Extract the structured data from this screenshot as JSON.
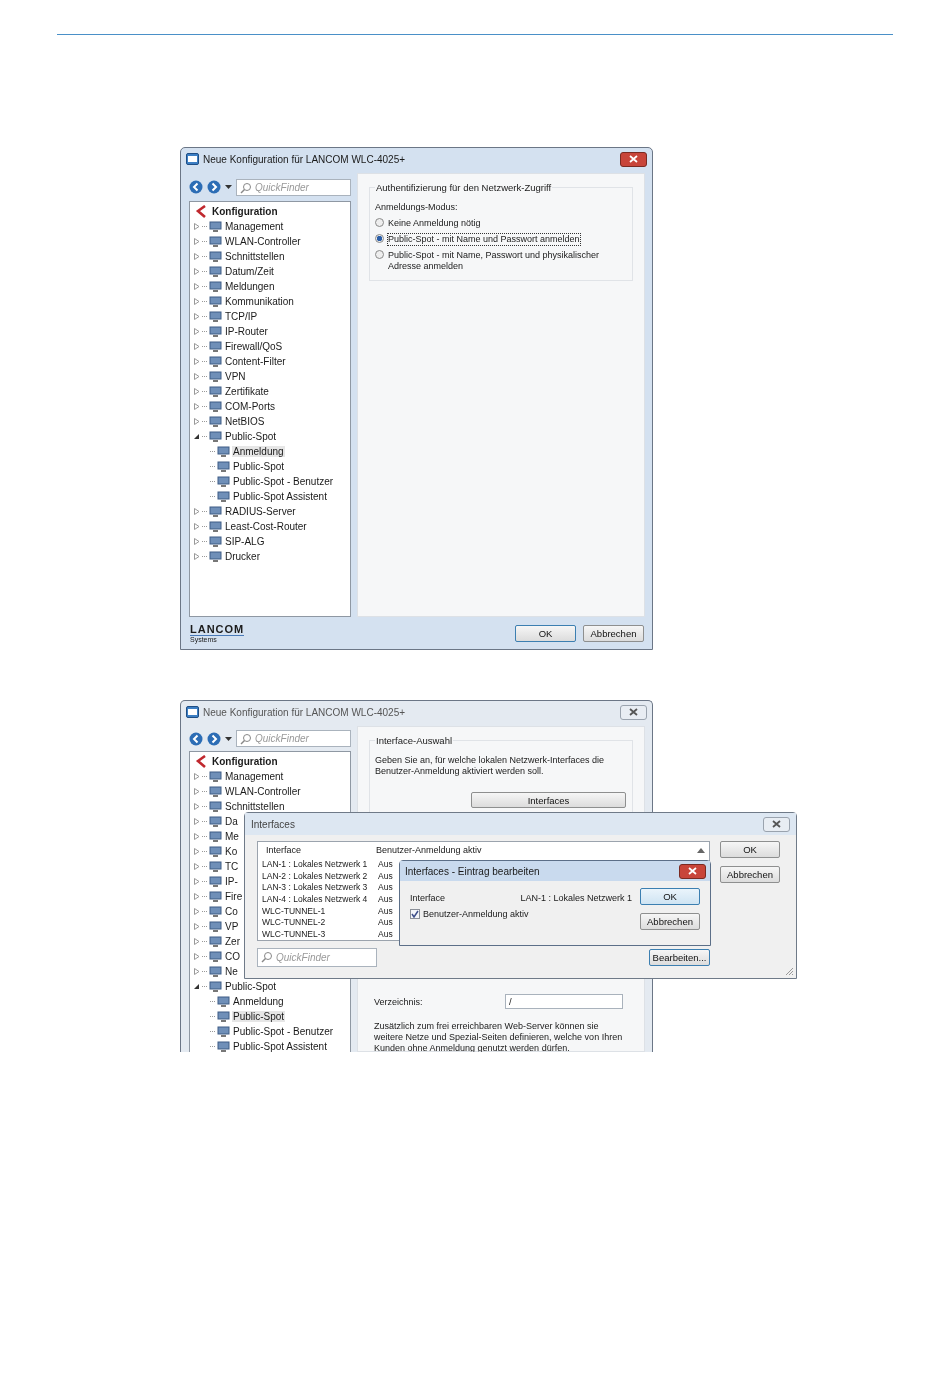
{
  "window_1": {
    "active": true,
    "title": "Neue Konfiguration für LANCOM WLC-4025+",
    "quickfinder": {
      "placeholder": "QuickFinder"
    },
    "tree": {
      "root": "Konfiguration",
      "items": [
        {
          "label": "Management",
          "expanded": false,
          "selected": false
        },
        {
          "label": "WLAN-Controller",
          "expanded": false,
          "selected": false
        },
        {
          "label": "Schnittstellen",
          "expanded": false,
          "selected": false
        },
        {
          "label": "Datum/Zeit",
          "expanded": false,
          "selected": false
        },
        {
          "label": "Meldungen",
          "expanded": false,
          "selected": false
        },
        {
          "label": "Kommunikation",
          "expanded": false,
          "selected": false
        },
        {
          "label": "TCP/IP",
          "expanded": false,
          "selected": false
        },
        {
          "label": "IP-Router",
          "expanded": false,
          "selected": false
        },
        {
          "label": "Firewall/QoS",
          "expanded": false,
          "selected": false
        },
        {
          "label": "Content-Filter",
          "expanded": false,
          "selected": false
        },
        {
          "label": "VPN",
          "expanded": false,
          "selected": false
        },
        {
          "label": "Zertifikate",
          "expanded": false,
          "selected": false
        },
        {
          "label": "COM-Ports",
          "expanded": false,
          "selected": false
        },
        {
          "label": "NetBIOS",
          "expanded": false,
          "selected": false
        },
        {
          "label": "Public-Spot",
          "expanded": true,
          "selected": false,
          "children": [
            {
              "label": "Anmeldung",
              "selected": true
            },
            {
              "label": "Public-Spot",
              "selected": false
            },
            {
              "label": "Public-Spot - Benutzer",
              "selected": false
            },
            {
              "label": "Public-Spot Assistent",
              "selected": false
            }
          ]
        },
        {
          "label": "RADIUS-Server",
          "expanded": false,
          "selected": false
        },
        {
          "label": "Least-Cost-Router",
          "expanded": false,
          "selected": false
        },
        {
          "label": "SIP-ALG",
          "expanded": false,
          "selected": false
        },
        {
          "label": "Drucker",
          "expanded": false,
          "selected": false
        }
      ]
    },
    "group": {
      "title": "Authentifizierung für den Netzwerk-Zugriff",
      "label": "Anmeldungs-Modus:",
      "radios": [
        {
          "label": "Keine Anmeldung nötig",
          "selected": false
        },
        {
          "label": "Public-Spot - mit Name und Passwort anmelden",
          "selected": true
        },
        {
          "label": "Public-Spot - mit Name, Passwort und physikalischer Adresse anmelden",
          "selected": false
        }
      ]
    },
    "logo": {
      "name": "LANCOM",
      "sub": "Systems"
    },
    "buttons": [
      "OK",
      "Abbrechen"
    ]
  },
  "window_2": {
    "active": false,
    "title": "Neue Konfiguration für LANCOM WLC-4025+",
    "quickfinder": {
      "placeholder": "QuickFinder"
    },
    "tree": {
      "root": "Konfiguration",
      "items": [
        {
          "label": "Management",
          "expanded": false,
          "selected": false
        },
        {
          "label": "WLAN-Controller",
          "expanded": false,
          "selected": false
        },
        {
          "label": "Schnittstellen",
          "expanded": false,
          "selected": false
        },
        {
          "label": "Da",
          "expanded": false,
          "selected": false
        },
        {
          "label": "Me",
          "expanded": false,
          "selected": false
        },
        {
          "label": "Ko",
          "expanded": false,
          "selected": false
        },
        {
          "label": "TC",
          "expanded": false,
          "selected": false
        },
        {
          "label": "IP-",
          "expanded": false,
          "selected": false
        },
        {
          "label": "Fire",
          "expanded": false,
          "selected": false
        },
        {
          "label": "Co",
          "expanded": false,
          "selected": false
        },
        {
          "label": "VP",
          "expanded": false,
          "selected": false
        },
        {
          "label": "Zer",
          "expanded": false,
          "selected": false
        },
        {
          "label": "CO",
          "expanded": false,
          "selected": false
        },
        {
          "label": "Ne",
          "expanded": false,
          "selected": false
        },
        {
          "label": "Public-Spot",
          "expanded": true,
          "selected": false,
          "children": [
            {
              "label": "Anmeldung",
              "selected": false
            },
            {
              "label": "Public-Spot",
              "selected": true
            },
            {
              "label": "Public-Spot - Benutzer",
              "selected": false
            },
            {
              "label": "Public-Spot Assistent",
              "selected": false
            }
          ]
        }
      ]
    },
    "group": {
      "title": "Interface-Auswahl",
      "description": "Geben Sie an, für welche lokalen Netzwerk-Interfaces die Benutzer-Anmeldung aktiviert werden soll.",
      "button": "Interfaces"
    },
    "directory": {
      "label": "Verzeichnis:",
      "value": "/"
    },
    "note": "Zusätzlich zum frei erreichbaren Web-Server können sie weitere Netze und Spezial-Seiten definieren, welche von Ihren Kunden ohne Anmeldung genutzt werden dürfen."
  },
  "interfaces_dialog": {
    "title": "Interfaces",
    "columns": [
      "Interface",
      "Benutzer-Anmeldung aktiv"
    ],
    "rows": [
      {
        "interface": "LAN-1 : Lokales Netzwerk 1",
        "status": "Aus"
      },
      {
        "interface": "LAN-2 : Lokales Netzwerk 2",
        "status": "Aus"
      },
      {
        "interface": "LAN-3 : Lokales Netzwerk 3",
        "status": "Aus"
      },
      {
        "interface": "LAN-4 : Lokales Netzwerk 4",
        "status": "Aus"
      },
      {
        "interface": "WLC-TUNNEL-1",
        "status": "Aus"
      },
      {
        "interface": "WLC-TUNNEL-2",
        "status": "Aus"
      },
      {
        "interface": "WLC-TUNNEL-3",
        "status": "Aus"
      }
    ],
    "buttons": [
      "OK",
      "Abbrechen"
    ],
    "quickfinder": {
      "placeholder": "QuickFinder"
    },
    "edit_button": "Bearbeiten..."
  },
  "edit_dialog": {
    "title": "Interfaces - Eintrag bearbeiten",
    "field_label": "Interface",
    "field_value": "LAN-1 : Lokales Netzwerk 1",
    "checkbox": {
      "label": "Benutzer-Anmeldung aktiv",
      "checked": true
    },
    "buttons": [
      "OK",
      "Abbrechen"
    ]
  }
}
